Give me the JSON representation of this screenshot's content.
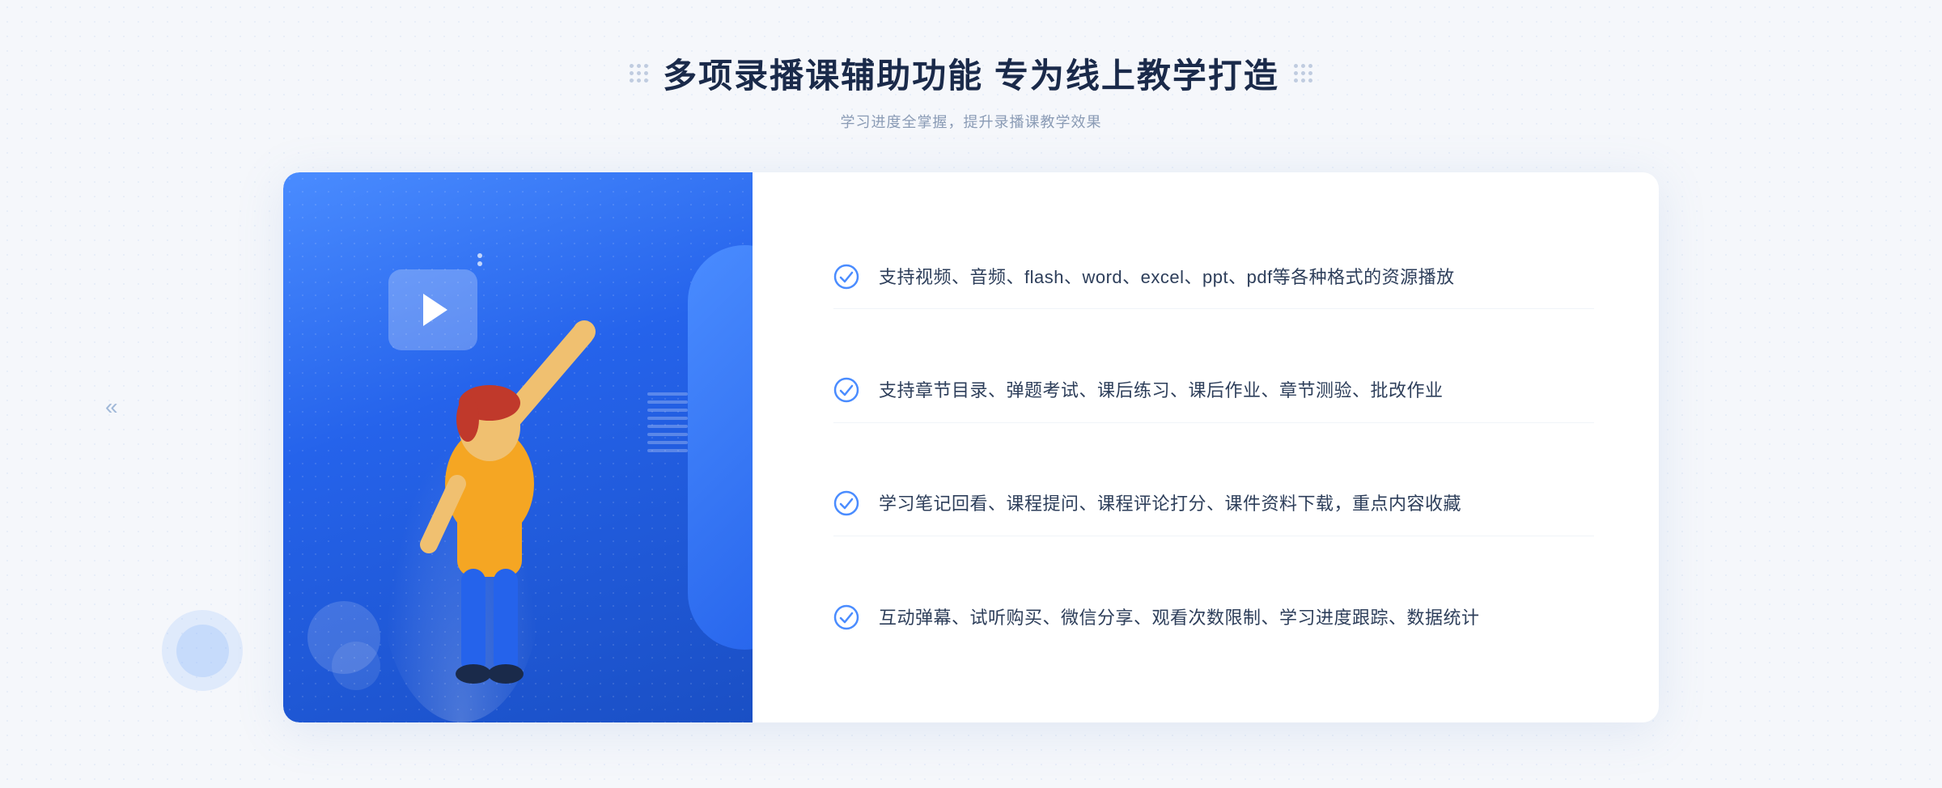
{
  "header": {
    "main_title": "多项录播课辅助功能 专为线上教学打造",
    "sub_title": "学习进度全掌握，提升录播课教学效果"
  },
  "features": [
    {
      "id": "feature-1",
      "text": "支持视频、音频、flash、word、excel、ppt、pdf等各种格式的资源播放"
    },
    {
      "id": "feature-2",
      "text": "支持章节目录、弹题考试、课后练习、课后作业、章节测验、批改作业"
    },
    {
      "id": "feature-3",
      "text": "学习笔记回看、课程提问、课程评论打分、课件资料下载，重点内容收藏"
    },
    {
      "id": "feature-4",
      "text": "互动弹幕、试听购买、微信分享、观看次数限制、学习进度跟踪、数据统计"
    }
  ],
  "colors": {
    "accent_blue": "#2563eb",
    "light_blue": "#4a8cff",
    "text_dark": "#1a2a4a",
    "text_muted": "#8a9bb5",
    "check_color": "#4a8cff"
  },
  "decoration": {
    "chevron_left": "«",
    "dot_label": "decorative-dots"
  }
}
